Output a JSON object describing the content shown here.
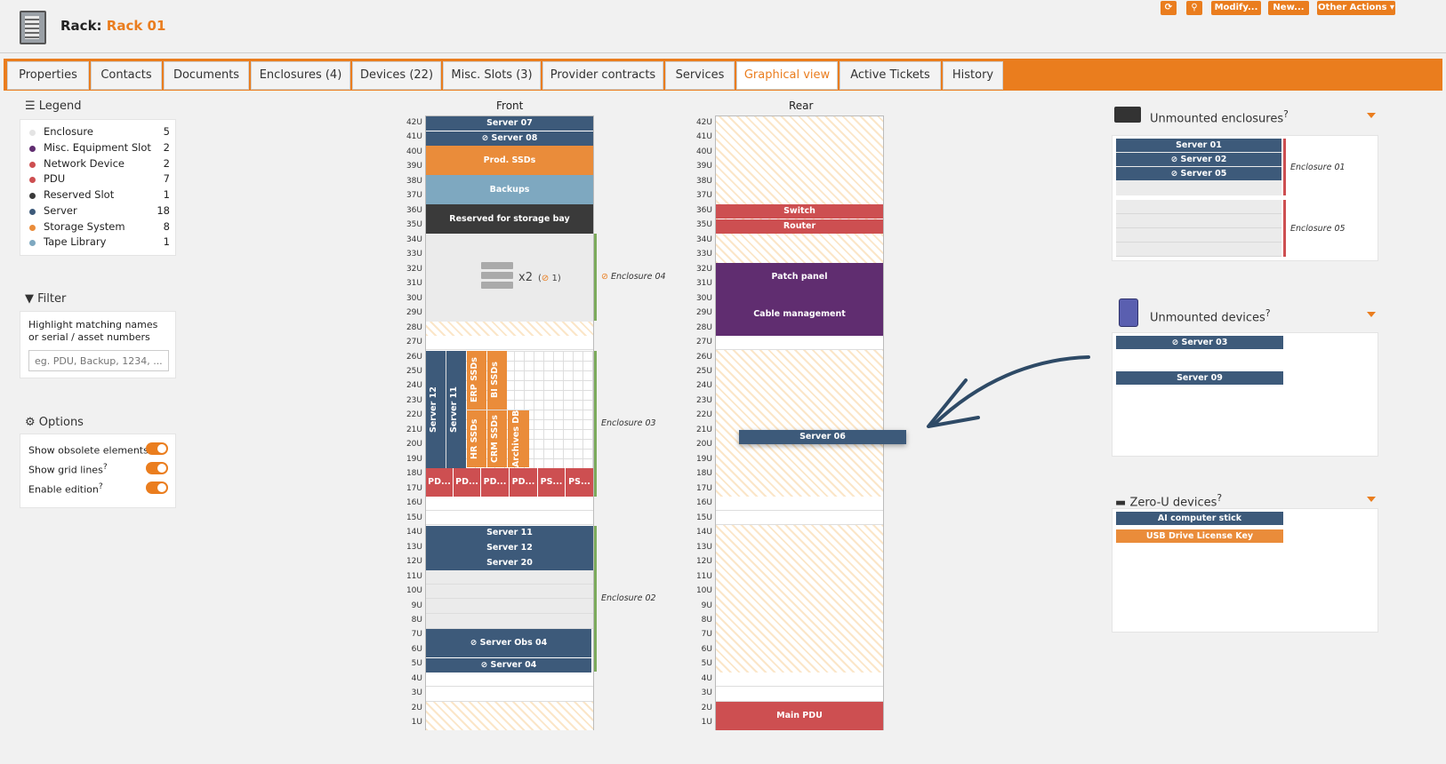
{
  "header": {
    "title_label": "Rack:",
    "rack_name": "Rack 01",
    "buttons": {
      "refresh": "⟳",
      "search": "⚲",
      "modify": "Modify...",
      "new": "New...",
      "other": "Other Actions"
    }
  },
  "tabs": [
    "Properties",
    "Contacts",
    "Documents",
    "Enclosures (4)",
    "Devices (22)",
    "Misc. Slots (3)",
    "Provider contracts",
    "Services",
    "Graphical view",
    "Active Tickets",
    "History"
  ],
  "active_tab": "Graphical view",
  "legend": {
    "title": "Legend",
    "items": [
      {
        "label": "Enclosure",
        "count": "5",
        "color": "#e4e4e4"
      },
      {
        "label": "Misc. Equipment Slot",
        "count": "2",
        "color": "#602d70"
      },
      {
        "label": "Network Device",
        "count": "2",
        "color": "#cd4f51"
      },
      {
        "label": "PDU",
        "count": "7",
        "color": "#cd4f51"
      },
      {
        "label": "Reserved Slot",
        "count": "1",
        "color": "#3a3a3a"
      },
      {
        "label": "Server",
        "count": "18",
        "color": "#3d5a7a"
      },
      {
        "label": "Storage System",
        "count": "8",
        "color": "#ea8c3a"
      },
      {
        "label": "Tape Library",
        "count": "1",
        "color": "#7ea8c0"
      }
    ]
  },
  "filter": {
    "title": "Filter",
    "hint": "Highlight matching names or serial / asset numbers",
    "placeholder": "eg. PDU, Backup, 1234, ..."
  },
  "options": {
    "title": "Options",
    "items": [
      "Show obsolete elements",
      "Show grid lines",
      "Enable edition"
    ],
    "help": "?"
  },
  "rack": {
    "front_label": "Front",
    "rear_label": "Rear",
    "front": {
      "server07": "Server 07",
      "server08": "Server 08",
      "prod_ssds": "Prod. SSDs",
      "backups": "Backups",
      "reserved": "Reserved for storage bay",
      "enclosure04_count": "x2",
      "enclosure04_obsolete": "1",
      "enclosure04": "Enclosure 04",
      "server12v": "Server 12",
      "server11v": "Server 11",
      "erp": "ERP SSDs",
      "bi": "BI SSDs",
      "hr": "HR SSDs",
      "crm": "CRM SSDs",
      "archives": "Archives DB",
      "pdus": [
        "PD...",
        "PD...",
        "PD...",
        "PD...",
        "PS...",
        "PS..."
      ],
      "enclosure03": "Enclosure 03",
      "server11": "Server 11",
      "server12": "Server 12",
      "server20": "Server 20",
      "server_obs04": "Server Obs 04",
      "server04": "Server 04",
      "enclosure02": "Enclosure 02"
    },
    "rear": {
      "switch": "Switch",
      "router": "Router",
      "patch_panel": "Patch panel",
      "cable_mgmt": "Cable management",
      "main_pdu": "Main PDU",
      "dragging": "Server 06"
    }
  },
  "unmounted_enclosures": {
    "title": "Unmounted enclosures",
    "enc01": {
      "label": "Enclosure 01",
      "devices": [
        "Server 01",
        "Server 02",
        "Server 05"
      ]
    },
    "enc05": {
      "label": "Enclosure 05"
    }
  },
  "unmounted_devices": {
    "title": "Unmounted devices",
    "devices": [
      "Server 03",
      "Server 09"
    ]
  },
  "zero_u": {
    "title": "Zero-U devices",
    "devices": [
      {
        "label": "AI computer stick",
        "color": "#3d5a7a"
      },
      {
        "label": "USB Drive License Key",
        "color": "#ea8c3a"
      }
    ]
  }
}
